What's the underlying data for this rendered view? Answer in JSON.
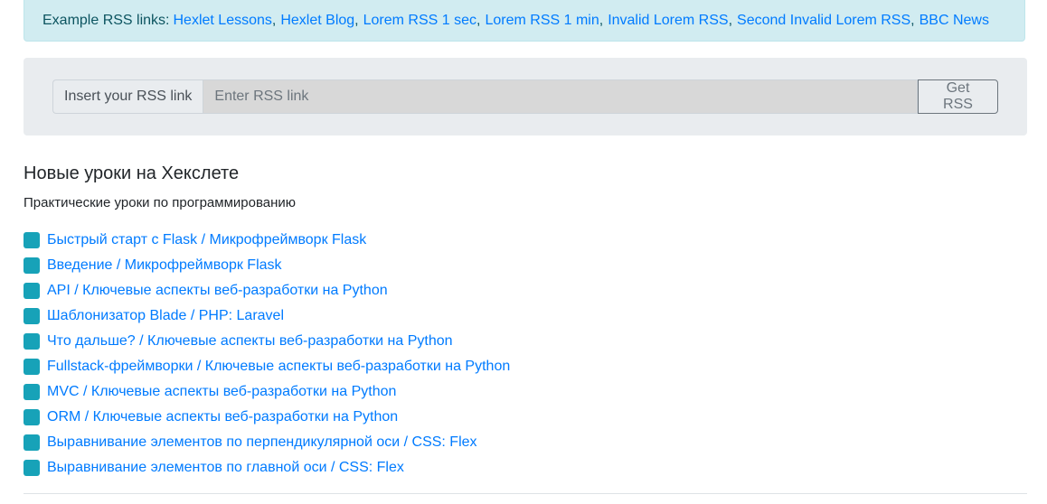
{
  "alert": {
    "lead": "Example RSS links:",
    "links": [
      "Hexlet Lessons",
      "Hexlet Blog",
      "Lorem RSS 1 sec",
      "Lorem RSS 1 min",
      "Invalid Lorem RSS",
      "Second Invalid Lorem RSS",
      "BBC News"
    ],
    "separator": ","
  },
  "form": {
    "prepend_label": "Insert your RSS link",
    "input_placeholder": "Enter RSS link",
    "input_value": "",
    "submit_label": "Get RSS"
  },
  "feed": {
    "title": "Новые уроки на Хекслете",
    "description": "Практические уроки по программированию",
    "posts": [
      "Быстрый старт с Flask / Микрофреймворк Flask",
      "Введение / Микрофреймворк Flask",
      "API / Ключевые аспекты веб-разработки на Python",
      "Шаблонизатор Blade / PHP: Laravel",
      "Что дальше? / Ключевые аспекты веб-разработки на Python",
      "Fullstack-фреймворки / Ключевые аспекты веб-разработки на Python",
      "MVC / Ключевые аспекты веб-разработки на Python",
      "ORM / Ключевые аспекты веб-разработки на Python",
      "Выравнивание элементов по перпендикулярной оси / CSS: Flex",
      "Выравнивание элементов по главной оси / CSS: Flex"
    ]
  },
  "colors": {
    "alert_bg": "#d1ecf1",
    "link": "#007bff",
    "marker": "#17a2b8",
    "jumbotron_bg": "#e9ecef"
  },
  "icons": {
    "post_marker": "square-marker-icon"
  }
}
